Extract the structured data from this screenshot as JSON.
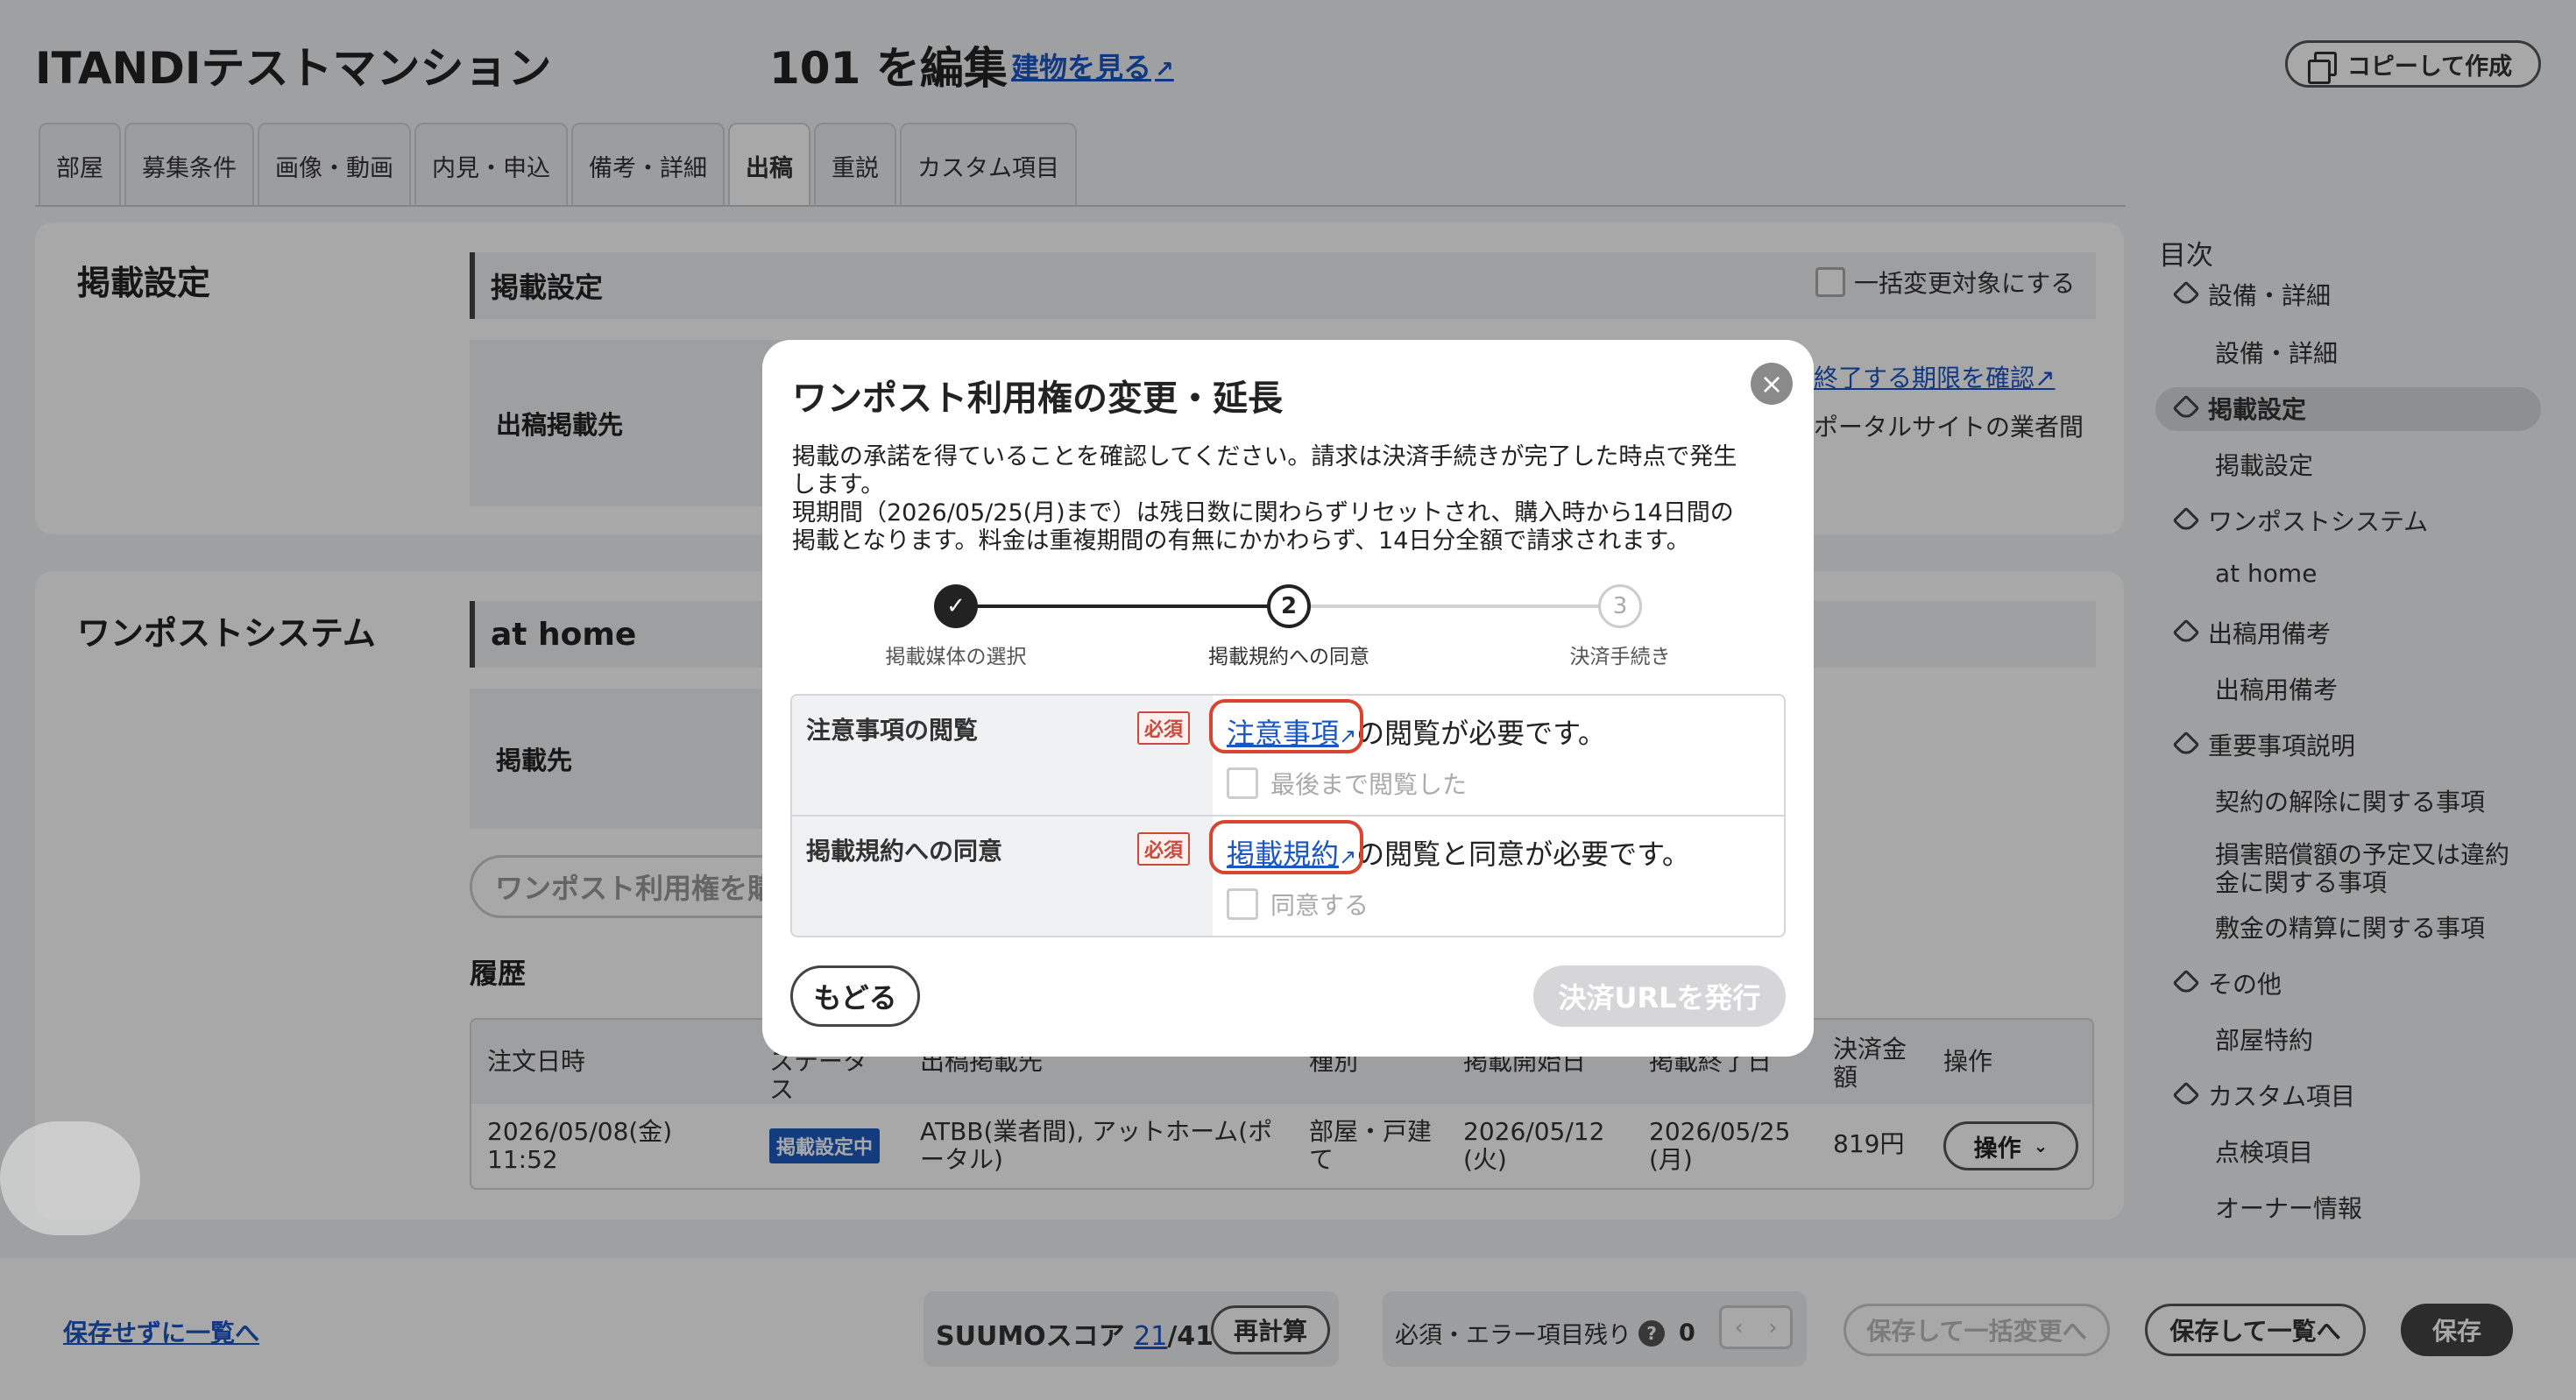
{
  "header": {
    "building_name": "ITANDIテストマンション",
    "edit_title": "101 を編集",
    "view_building_link": "建物を見る",
    "copy_button": "コピーして作成"
  },
  "tabs": [
    "部屋",
    "募集条件",
    "画像・動画",
    "内見・申込",
    "備考・詳細",
    "出稿",
    "重説",
    "カスタム項目"
  ],
  "active_tab": "出稿",
  "listing_settings": {
    "section_title": "掲載設定",
    "sub_head": "掲載設定",
    "bulk_checkbox_label": "一括変更対象にする",
    "row_label": "出稿掲載先",
    "deadline_link": "終了する期限を確認",
    "portal_note": "ポータルサイトの業者間"
  },
  "onepost": {
    "section_title": "ワンポストシステム",
    "sub_head": "at home",
    "row_label": "掲載先",
    "purchase_input": "ワンポスト利用権を購",
    "history_label": "履歴",
    "table": {
      "headers": [
        "注文日時",
        "ステータス",
        "出稿掲載先",
        "種別",
        "掲載開始日",
        "掲載終了日",
        "決済金額",
        "操作"
      ],
      "rows": [
        {
          "order_date": "2026/05/08(金)",
          "order_time": "11:52",
          "status": "掲載設定中",
          "destination_1": "ATBB(業者間), アットホーム(ポ",
          "destination_2": "ータル)",
          "type_1": "部屋・戸建",
          "type_2": "て",
          "start_1": "2026/05/12",
          "start_2": "(火)",
          "end_1": "2026/05/25",
          "end_2": "(月)",
          "amount": "819円",
          "action": "操作"
        }
      ]
    }
  },
  "toc": {
    "heading": "目次",
    "items": [
      {
        "type": "section",
        "label": "設備・詳細"
      },
      {
        "type": "sub",
        "label": "設備・詳細"
      },
      {
        "type": "section",
        "label": "掲載設定",
        "active": true
      },
      {
        "type": "sub",
        "label": "掲載設定"
      },
      {
        "type": "section",
        "label": "ワンポストシステム"
      },
      {
        "type": "sub",
        "label": "at home"
      },
      {
        "type": "section",
        "label": "出稿用備考"
      },
      {
        "type": "sub",
        "label": "出稿用備考"
      },
      {
        "type": "section",
        "label": "重要事項説明"
      },
      {
        "type": "sub",
        "label": "契約の解除に関する事項"
      },
      {
        "type": "sub",
        "label": "損害賠償額の予定又は違約"
      },
      {
        "type": "sub",
        "label": "金に関する事項"
      },
      {
        "type": "sub",
        "label": "敷金の精算に関する事項"
      },
      {
        "type": "section",
        "label": "その他"
      },
      {
        "type": "sub",
        "label": "部屋特約"
      },
      {
        "type": "section",
        "label": "カスタム項目"
      },
      {
        "type": "sub",
        "label": "点検項目"
      },
      {
        "type": "sub",
        "label": "オーナー情報"
      }
    ]
  },
  "footer": {
    "back_without_save": "保存せずに一覧へ",
    "suumo_label": "SUUMOスコア",
    "suumo_score": "21",
    "suumo_total": "/41",
    "recalc_button": "再計算",
    "required_remaining_label": "必須・エラー項目残り",
    "required_remaining_count": "0",
    "save_bulk_button": "保存して一括変更へ",
    "save_list_button": "保存して一覧へ",
    "save_button": "保存"
  },
  "modal": {
    "title": "ワンポスト利用権の変更・延長",
    "description_1": "掲載の承諾を得ていることを確認してください。請求は決済手続きが完了した時点で発生",
    "description_2": "します。",
    "description_3": "現期間（2026/05/25(月)まで）は残日数に関わらずリセットされ、購入時から14日間の",
    "description_4": "掲載となります。料金は重複期間の有無にかかわらず、14日分全額で請求されます。",
    "steps": [
      {
        "number": "1",
        "label": "掲載媒体の選択",
        "state": "done"
      },
      {
        "number": "2",
        "label": "掲載規約への同意",
        "state": "current"
      },
      {
        "number": "3",
        "label": "決済手続き",
        "state": "upcoming"
      }
    ],
    "rows": [
      {
        "label": "注意事項の閲覧",
        "required_badge": "必須",
        "link_text": "注意事項",
        "text_after": "の閲覧が必要です。",
        "checkbox_label": "最後まで閲覧した"
      },
      {
        "label": "掲載規約への同意",
        "required_badge": "必須",
        "link_text": "掲載規約",
        "text_after": "の閲覧と同意が必要です。",
        "checkbox_label": "同意する"
      }
    ],
    "back_button": "もどる",
    "issue_button": "決済URLを発行",
    "close_icon": "close-icon"
  },
  "colors": {
    "link": "#1a56c4",
    "required": "#c94a3a",
    "highlight_ring": "#d9432f",
    "status_badge": "#1e5bbf"
  }
}
